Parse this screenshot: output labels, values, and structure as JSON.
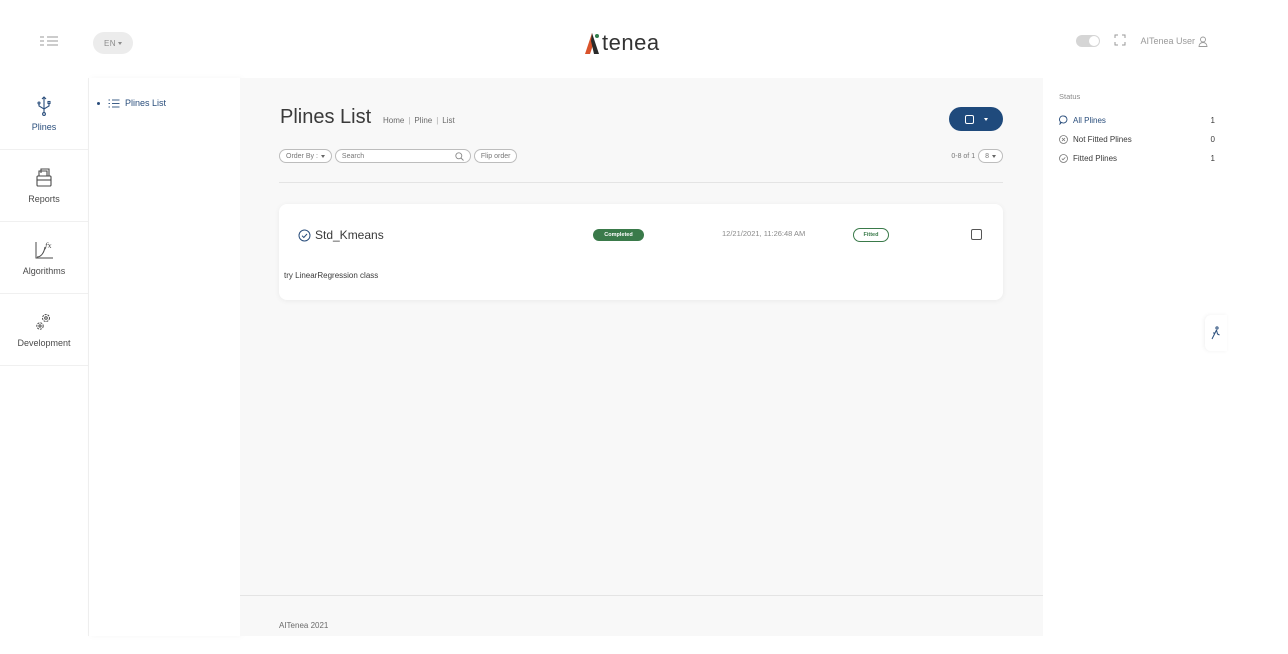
{
  "header": {
    "lang": "EN",
    "logo_text": "tenea",
    "user_name": "AITenea User"
  },
  "iconbar": {
    "items": [
      {
        "label": "Plines",
        "icon": "usb-icon"
      },
      {
        "label": "Reports",
        "icon": "reports-icon"
      },
      {
        "label": "Algorithms",
        "icon": "function-chart-icon"
      },
      {
        "label": "Development",
        "icon": "gears-icon"
      }
    ]
  },
  "submenu": {
    "items": [
      {
        "label": "Plines List"
      }
    ]
  },
  "main": {
    "title": "Plines List",
    "breadcrumb": [
      "Home",
      "Pline",
      "List"
    ],
    "order_by": "Order By :",
    "search_placeholder": "Search",
    "flip_order": "Flip order",
    "range": "0-8 of 1",
    "page_size": "8",
    "cards": [
      {
        "name": "Std_Kmeans",
        "status": "Completed",
        "date": "12/21/2021, 11:26:48 AM",
        "fit_status": "Fitted",
        "description": "try LinearRegression class"
      }
    ],
    "footer": "AITenea 2021"
  },
  "status_panel": {
    "heading": "Status",
    "rows": [
      {
        "label": "All Plines",
        "count": "1",
        "icon": "chat-bubble-icon"
      },
      {
        "label": "Not Fitted Plines",
        "count": "0",
        "icon": "x-circle-icon"
      },
      {
        "label": "Fitted Plines",
        "count": "1",
        "icon": "check-circle-icon"
      }
    ]
  },
  "colors": {
    "primary": "#1f4a7c",
    "success": "#3a7a4a",
    "logo_accent": "#d9532b"
  }
}
